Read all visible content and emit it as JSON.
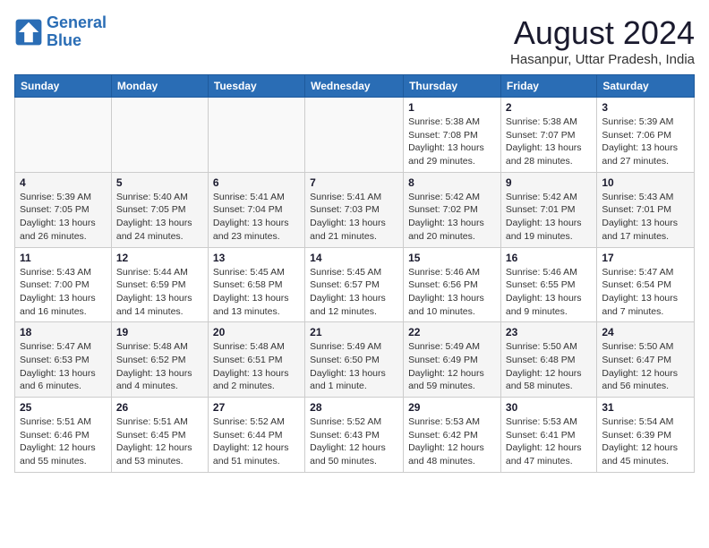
{
  "logo": {
    "line1": "General",
    "line2": "Blue"
  },
  "title": "August 2024",
  "location": "Hasanpur, Uttar Pradesh, India",
  "days_of_week": [
    "Sunday",
    "Monday",
    "Tuesday",
    "Wednesday",
    "Thursday",
    "Friday",
    "Saturday"
  ],
  "weeks": [
    [
      {
        "day": "",
        "info": ""
      },
      {
        "day": "",
        "info": ""
      },
      {
        "day": "",
        "info": ""
      },
      {
        "day": "",
        "info": ""
      },
      {
        "day": "1",
        "info": "Sunrise: 5:38 AM\nSunset: 7:08 PM\nDaylight: 13 hours\nand 29 minutes."
      },
      {
        "day": "2",
        "info": "Sunrise: 5:38 AM\nSunset: 7:07 PM\nDaylight: 13 hours\nand 28 minutes."
      },
      {
        "day": "3",
        "info": "Sunrise: 5:39 AM\nSunset: 7:06 PM\nDaylight: 13 hours\nand 27 minutes."
      }
    ],
    [
      {
        "day": "4",
        "info": "Sunrise: 5:39 AM\nSunset: 7:05 PM\nDaylight: 13 hours\nand 26 minutes."
      },
      {
        "day": "5",
        "info": "Sunrise: 5:40 AM\nSunset: 7:05 PM\nDaylight: 13 hours\nand 24 minutes."
      },
      {
        "day": "6",
        "info": "Sunrise: 5:41 AM\nSunset: 7:04 PM\nDaylight: 13 hours\nand 23 minutes."
      },
      {
        "day": "7",
        "info": "Sunrise: 5:41 AM\nSunset: 7:03 PM\nDaylight: 13 hours\nand 21 minutes."
      },
      {
        "day": "8",
        "info": "Sunrise: 5:42 AM\nSunset: 7:02 PM\nDaylight: 13 hours\nand 20 minutes."
      },
      {
        "day": "9",
        "info": "Sunrise: 5:42 AM\nSunset: 7:01 PM\nDaylight: 13 hours\nand 19 minutes."
      },
      {
        "day": "10",
        "info": "Sunrise: 5:43 AM\nSunset: 7:01 PM\nDaylight: 13 hours\nand 17 minutes."
      }
    ],
    [
      {
        "day": "11",
        "info": "Sunrise: 5:43 AM\nSunset: 7:00 PM\nDaylight: 13 hours\nand 16 minutes."
      },
      {
        "day": "12",
        "info": "Sunrise: 5:44 AM\nSunset: 6:59 PM\nDaylight: 13 hours\nand 14 minutes."
      },
      {
        "day": "13",
        "info": "Sunrise: 5:45 AM\nSunset: 6:58 PM\nDaylight: 13 hours\nand 13 minutes."
      },
      {
        "day": "14",
        "info": "Sunrise: 5:45 AM\nSunset: 6:57 PM\nDaylight: 13 hours\nand 12 minutes."
      },
      {
        "day": "15",
        "info": "Sunrise: 5:46 AM\nSunset: 6:56 PM\nDaylight: 13 hours\nand 10 minutes."
      },
      {
        "day": "16",
        "info": "Sunrise: 5:46 AM\nSunset: 6:55 PM\nDaylight: 13 hours\nand 9 minutes."
      },
      {
        "day": "17",
        "info": "Sunrise: 5:47 AM\nSunset: 6:54 PM\nDaylight: 13 hours\nand 7 minutes."
      }
    ],
    [
      {
        "day": "18",
        "info": "Sunrise: 5:47 AM\nSunset: 6:53 PM\nDaylight: 13 hours\nand 6 minutes."
      },
      {
        "day": "19",
        "info": "Sunrise: 5:48 AM\nSunset: 6:52 PM\nDaylight: 13 hours\nand 4 minutes."
      },
      {
        "day": "20",
        "info": "Sunrise: 5:48 AM\nSunset: 6:51 PM\nDaylight: 13 hours\nand 2 minutes."
      },
      {
        "day": "21",
        "info": "Sunrise: 5:49 AM\nSunset: 6:50 PM\nDaylight: 13 hours\nand 1 minute."
      },
      {
        "day": "22",
        "info": "Sunrise: 5:49 AM\nSunset: 6:49 PM\nDaylight: 12 hours\nand 59 minutes."
      },
      {
        "day": "23",
        "info": "Sunrise: 5:50 AM\nSunset: 6:48 PM\nDaylight: 12 hours\nand 58 minutes."
      },
      {
        "day": "24",
        "info": "Sunrise: 5:50 AM\nSunset: 6:47 PM\nDaylight: 12 hours\nand 56 minutes."
      }
    ],
    [
      {
        "day": "25",
        "info": "Sunrise: 5:51 AM\nSunset: 6:46 PM\nDaylight: 12 hours\nand 55 minutes."
      },
      {
        "day": "26",
        "info": "Sunrise: 5:51 AM\nSunset: 6:45 PM\nDaylight: 12 hours\nand 53 minutes."
      },
      {
        "day": "27",
        "info": "Sunrise: 5:52 AM\nSunset: 6:44 PM\nDaylight: 12 hours\nand 51 minutes."
      },
      {
        "day": "28",
        "info": "Sunrise: 5:52 AM\nSunset: 6:43 PM\nDaylight: 12 hours\nand 50 minutes."
      },
      {
        "day": "29",
        "info": "Sunrise: 5:53 AM\nSunset: 6:42 PM\nDaylight: 12 hours\nand 48 minutes."
      },
      {
        "day": "30",
        "info": "Sunrise: 5:53 AM\nSunset: 6:41 PM\nDaylight: 12 hours\nand 47 minutes."
      },
      {
        "day": "31",
        "info": "Sunrise: 5:54 AM\nSunset: 6:39 PM\nDaylight: 12 hours\nand 45 minutes."
      }
    ]
  ]
}
